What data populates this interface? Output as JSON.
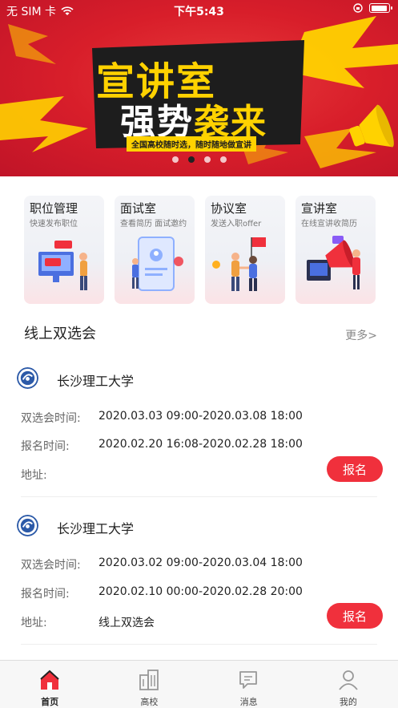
{
  "status_bar": {
    "carrier": "无 SIM 卡",
    "time": "下午5:43"
  },
  "banner": {
    "headline_1": "宣讲室",
    "headline_2_a": "强势",
    "headline_2_b": "袭来",
    "tagline": "全国高校随时选，随时随地做宣讲",
    "dots": 4,
    "active_dot": 1
  },
  "features": [
    {
      "title": "职位管理",
      "subtitle": "快速发布职位"
    },
    {
      "title": "面试室",
      "subtitle": "查看简历 面试邀约"
    },
    {
      "title": "协议室",
      "subtitle": "发送入职offer"
    },
    {
      "title": "宣讲室",
      "subtitle": "在线宣讲收简历"
    }
  ],
  "section": {
    "title": "线上双选会",
    "more": "更多>"
  },
  "listings": [
    {
      "school": "长沙理工大学",
      "fair_time_label": "双选会时间:",
      "fair_time": "2020.03.03 09:00-2020.03.08 18:00",
      "signup_time_label": "报名时间:",
      "signup_time": "2020.02.20 16:08-2020.02.28 18:00",
      "address_label": "地址:",
      "address": "",
      "button": "报名"
    },
    {
      "school": "长沙理工大学",
      "fair_time_label": "双选会时间:",
      "fair_time": "2020.03.02 09:00-2020.03.04 18:00",
      "signup_time_label": "报名时间:",
      "signup_time": "2020.02.10 00:00-2020.02.28 20:00",
      "address_label": "地址:",
      "address": "线上双选会",
      "button": "报名"
    }
  ],
  "tab_bar": [
    {
      "label": "首页",
      "icon": "home-icon",
      "active": true
    },
    {
      "label": "高校",
      "icon": "building-icon",
      "active": false
    },
    {
      "label": "消息",
      "icon": "message-icon",
      "active": false
    },
    {
      "label": "我的",
      "icon": "profile-icon",
      "active": false
    }
  ],
  "colors": {
    "accent": "#f0303c",
    "banner_red": "#d81e2a",
    "banner_yellow": "#ffd200",
    "logo_blue": "#2c5aa8"
  }
}
